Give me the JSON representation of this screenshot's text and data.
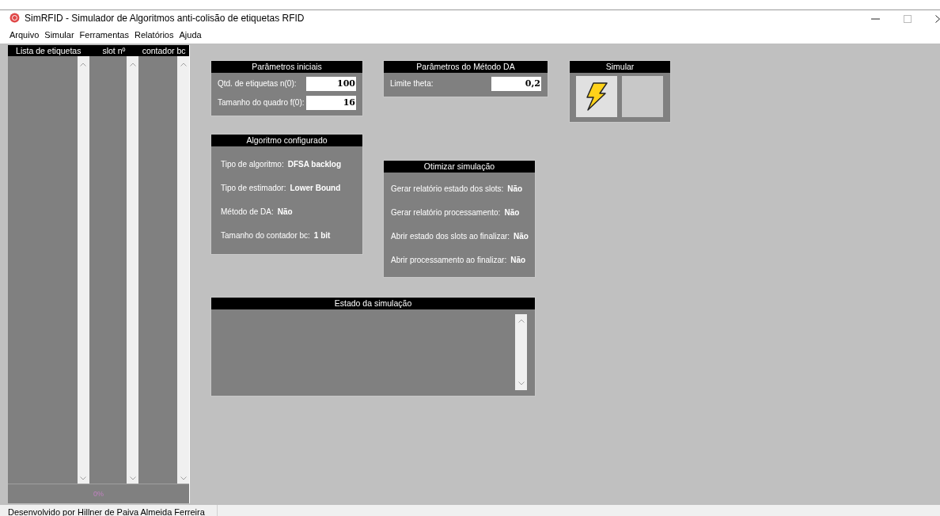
{
  "window": {
    "title": "SimRFID - Simulador de Algoritmos anti-colisão de etiquetas RFID"
  },
  "menu": [
    "Arquivo",
    "Simular",
    "Ferramentas",
    "Relatórios",
    "Ajuda"
  ],
  "tag_list": {
    "columns": [
      "Lista de etiquetas",
      "slot nº",
      "contador bc"
    ],
    "progress": {
      "level": 0,
      "text": "0%"
    }
  },
  "panels": [
    {
      "kind": "fields",
      "title": "Parâmetros iniciais",
      "fields": [
        {
          "label": "Qtd. de etiquetas n(0):",
          "value": "100"
        },
        {
          "label": "Tamanho do quadro f(0):",
          "value": "16"
        }
      ]
    },
    {
      "kind": "rows",
      "title": "Algoritmo configurado",
      "rows": [
        {
          "label": "Tipo de algoritmo:",
          "value": "DFSA backlog"
        },
        {
          "label": "Tipo de estimador:",
          "value": "Lower Bound"
        },
        {
          "label": "Método de DA:",
          "value": "Não"
        },
        {
          "label": "Tamanho do contador bc:",
          "value": "1 bit"
        }
      ]
    },
    {
      "kind": "fields",
      "title": "Parâmetros do Método DA",
      "fields": [
        {
          "label": "Limite theta:",
          "value": "0,2"
        }
      ]
    },
    {
      "kind": "rows",
      "title": "Otimizar simulação",
      "rows": [
        {
          "label": "Gerar relatório estado dos slots:",
          "value": "Não"
        },
        {
          "label": "Gerar relatório processamento:",
          "value": "Não"
        },
        {
          "label": "Abrir estado dos slots ao finalizar:",
          "value": "Não"
        },
        {
          "label": "Abrir processamento ao finalizar:",
          "value": "Não"
        }
      ]
    },
    {
      "kind": "buttons",
      "title": "Simular",
      "buttons": [
        {
          "kind": "run"
        },
        {
          "kind": "blank"
        }
      ]
    },
    {
      "kind": "log",
      "title": "Estado da simulação"
    }
  ],
  "status_bar": {
    "text": "Desenvolvido por Hillner de Paiva Almeida Ferreira"
  }
}
